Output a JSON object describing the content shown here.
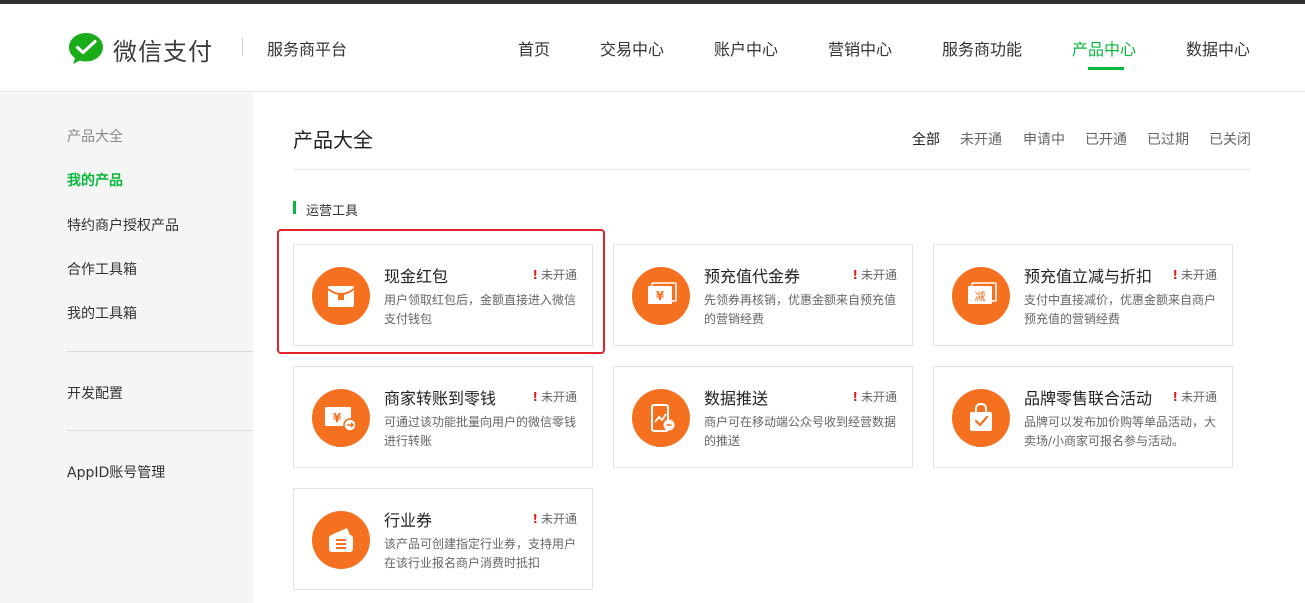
{
  "brand": {
    "logo_text": "微信支付",
    "platform": "服务商平台"
  },
  "nav": {
    "items": [
      "首页",
      "交易中心",
      "账户中心",
      "营销中心",
      "服务商功能",
      "产品中心",
      "数据中心"
    ],
    "active_index": 5
  },
  "sidebar": {
    "heading": "产品大全",
    "items": [
      "我的产品",
      "特约商户授权产品",
      "合作工具箱",
      "我的工具箱",
      "开发配置",
      "AppID账号管理"
    ],
    "active_index": 0
  },
  "main": {
    "title": "产品大全",
    "filters": [
      "全部",
      "未开通",
      "申请中",
      "已开通",
      "已过期",
      "已关闭"
    ],
    "active_filter": 0,
    "section": "运营工具",
    "products": [
      {
        "title": "现金红包",
        "status": "未开通",
        "desc": "用户领取红包后，金额直接进入微信支付钱包",
        "icon": "red-envelope-icon"
      },
      {
        "title": "预充值代金券",
        "status": "未开通",
        "desc": "先领券再核销，优惠金额来自预充值的营销经费",
        "icon": "yen-voucher-icon"
      },
      {
        "title": "预充值立减与折扣",
        "status": "未开通",
        "desc": "支付中直接减价，优惠金额来自商户预充值的营销经费",
        "icon": "discount-ticket-icon"
      },
      {
        "title": "商家转账到零钱",
        "status": "未开通",
        "desc": "可通过该功能批量向用户的微信零钱进行转账",
        "icon": "money-transfer-icon"
      },
      {
        "title": "数据推送",
        "status": "未开通",
        "desc": "商户可在移动端公众号收到经营数据的推送",
        "icon": "mobile-data-icon"
      },
      {
        "title": "品牌零售联合活动",
        "status": "未开通",
        "desc": "品牌可以发布加价购等单品活动，大卖场/小商家可报名参与活动。",
        "icon": "shopping-bag-icon"
      },
      {
        "title": "行业券",
        "status": "未开通",
        "desc": "该产品可创建指定行业券，支持用户在该行业报名商户消费时抵扣",
        "icon": "wallet-coupon-icon"
      }
    ]
  },
  "colors": {
    "accent": "#09b83e",
    "icon_bg": "#f5701f",
    "highlight": "#e0232a",
    "warning": "#e02020"
  }
}
